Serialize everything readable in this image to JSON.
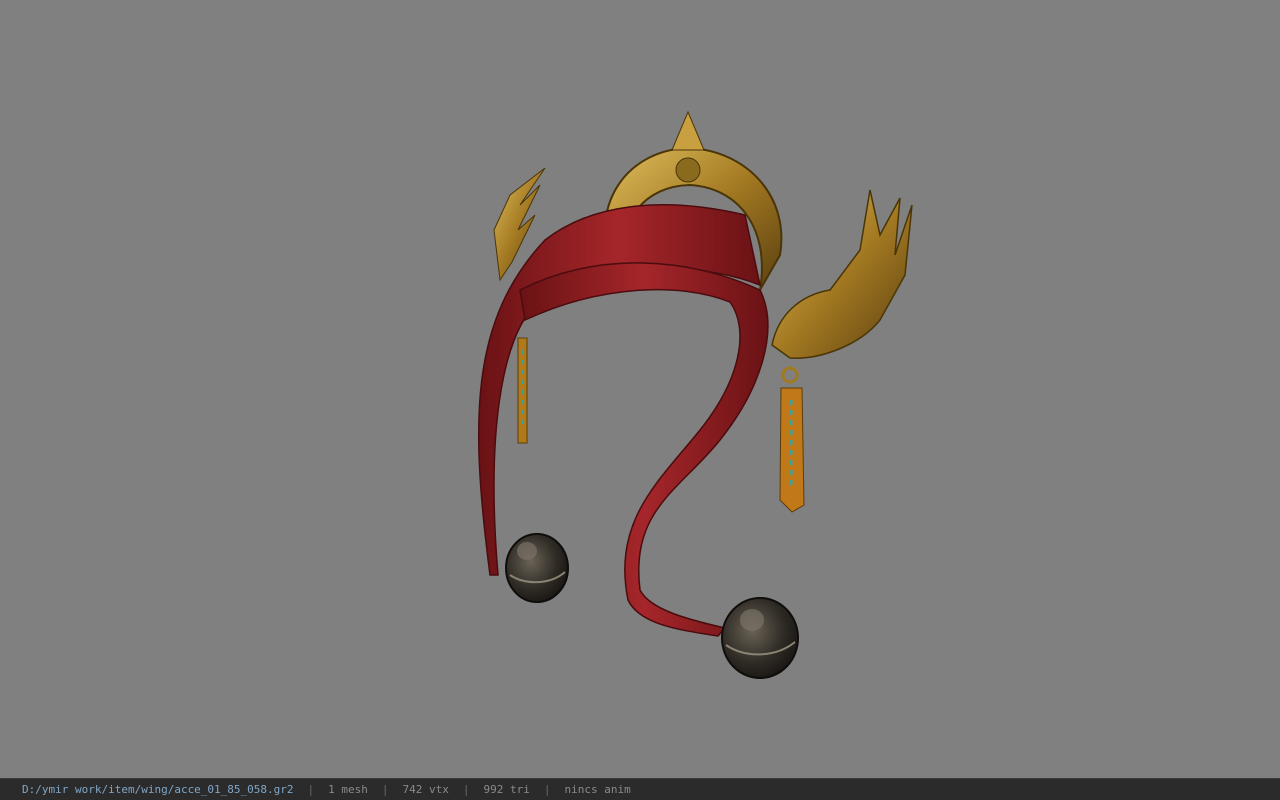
{
  "viewport": {
    "background": "#808080",
    "model_name": "headband accessory with red ribbons and golden dragon ornaments"
  },
  "status_bar": {
    "file_path": "D:/ymir work/item/wing/acce_01_85_058.gr2",
    "separator": "|",
    "mesh": "1 mesh",
    "vertices": "742 vtx",
    "triangles": "992 tri",
    "animation": "nincs anim"
  },
  "colors": {
    "ribbon": "#8e1c1f",
    "ribbon_dark": "#5e1012",
    "gold": "#b08a2a",
    "gold_dark": "#6b4f12",
    "bell": "#2e2a24",
    "status_text": "#8a8a8a",
    "path_text": "#7fa6c7"
  }
}
